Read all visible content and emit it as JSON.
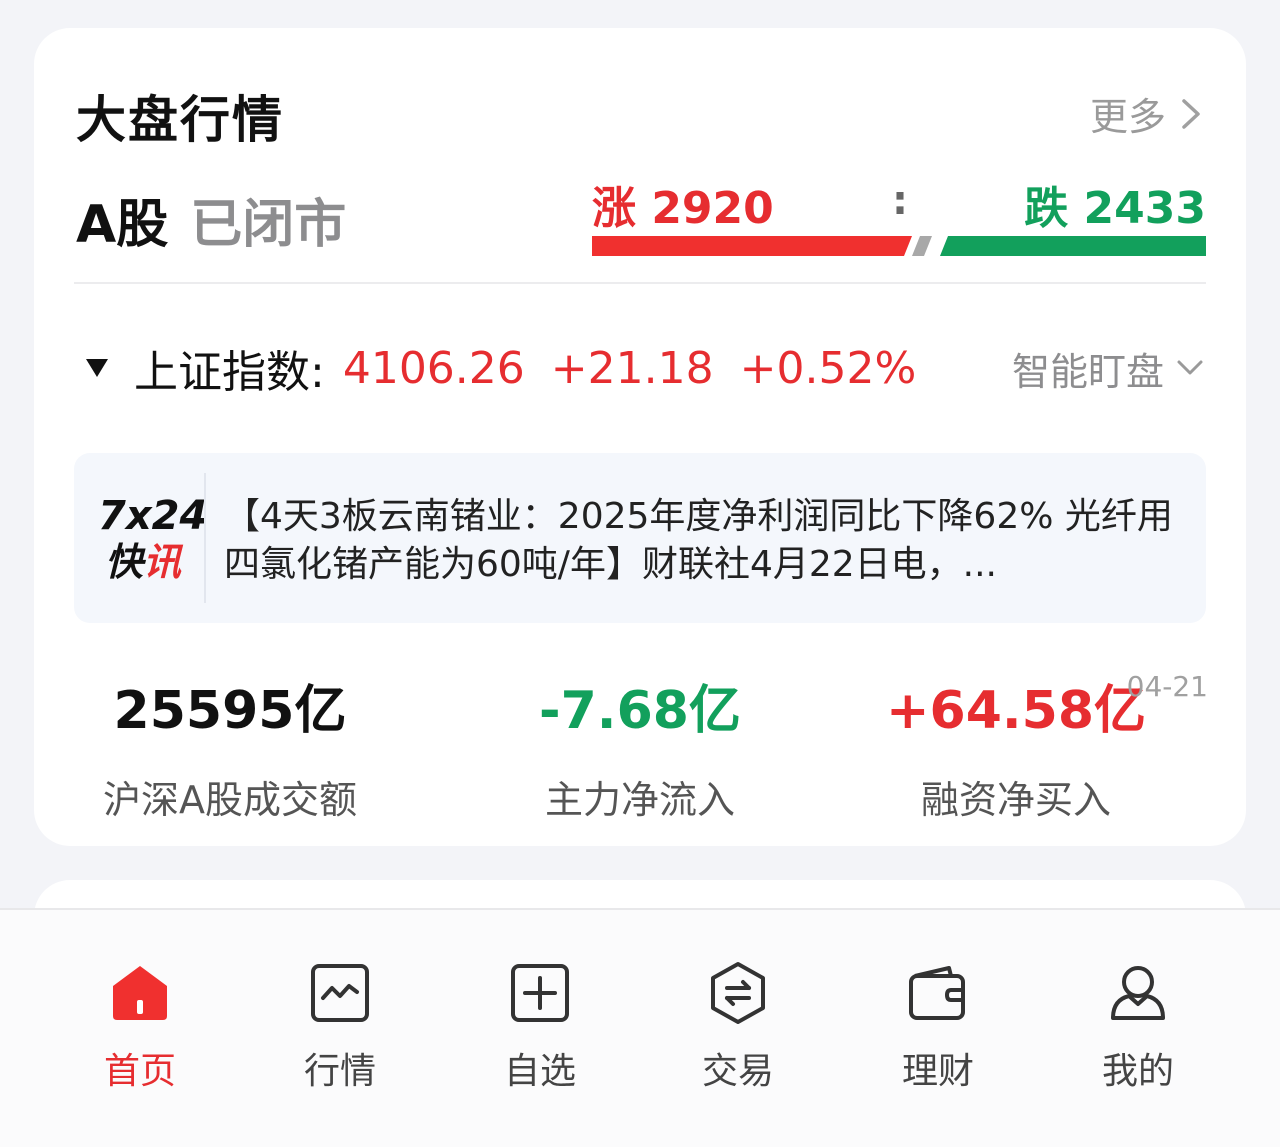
{
  "header": {
    "title": "大盘行情",
    "more_label": "更多"
  },
  "market": {
    "name": "A股",
    "status": "已闭市",
    "up_text": "涨 2920",
    "colon": ":",
    "down_text": "跌 2433",
    "up_count": 2920,
    "down_count": 2433
  },
  "index": {
    "name": "上证指数:",
    "value": "4106.26",
    "change": "+21.18",
    "percent": "+0.52%",
    "smart_label": "智能盯盘"
  },
  "news": {
    "logo_top": "7x24",
    "logo_bottom_a": "快",
    "logo_bottom_b": "讯",
    "text": "【4天3板云南锗业：2025年度净利润同比下降62% 光纤用四氯化锗产能为60吨/年】财联社4月22日电，..."
  },
  "stats": [
    {
      "value": "25595亿",
      "label": "沪深A股成交额",
      "color": "#111111"
    },
    {
      "value": "-7.68亿",
      "label": "主力净流入",
      "color": "#12a05c"
    },
    {
      "value": "+64.58亿",
      "label": "融资净买入",
      "color": "#e62d30"
    }
  ],
  "stats_date": "04-21",
  "colors": {
    "up": "#e62d30",
    "down": "#12a05c",
    "accent": "#e62d30"
  },
  "tabs": [
    {
      "label": "首页",
      "icon": "home-icon",
      "active": true
    },
    {
      "label": "行情",
      "icon": "chart-icon",
      "active": false
    },
    {
      "label": "自选",
      "icon": "add-box-icon",
      "active": false
    },
    {
      "label": "交易",
      "icon": "exchange-icon",
      "active": false
    },
    {
      "label": "理财",
      "icon": "wallet-icon",
      "active": false
    },
    {
      "label": "我的",
      "icon": "user-icon",
      "active": false
    }
  ]
}
